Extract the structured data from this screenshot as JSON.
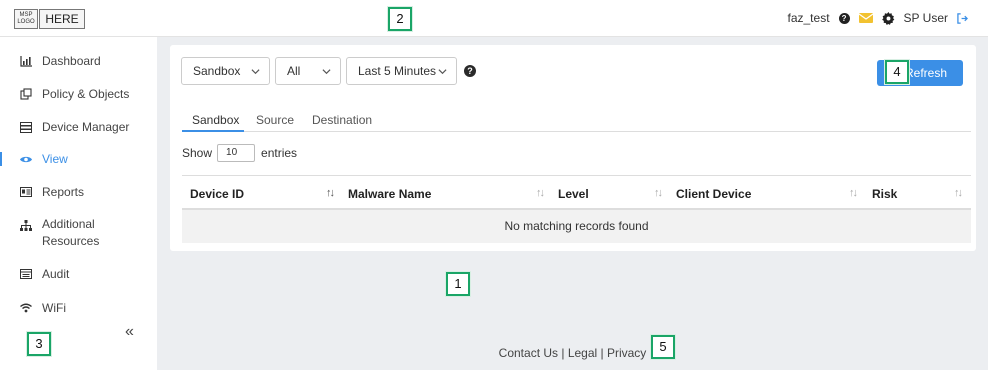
{
  "topbar": {
    "logo_text": "MSP LOGO",
    "here_label": "HERE",
    "username": "faz_test",
    "user_role_label": "SP User"
  },
  "sidebar": {
    "items": [
      {
        "label": "Dashboard",
        "icon": "bar-chart-icon"
      },
      {
        "label": "Policy & Objects",
        "icon": "objects-icon"
      },
      {
        "label": "Device Manager",
        "icon": "device-icon"
      },
      {
        "label": "View",
        "icon": "eye-icon",
        "active": true
      },
      {
        "label": "Reports",
        "icon": "reports-icon"
      },
      {
        "label": "Additional Resources",
        "icon": "sitemap-icon"
      },
      {
        "label": "Audit",
        "icon": "audit-icon"
      },
      {
        "label": "WiFi",
        "icon": "wifi-icon"
      }
    ],
    "collapse_label": "«"
  },
  "filters": {
    "type_value": "Sandbox",
    "scope_value": "All",
    "time_value": "Last 5 Minutes",
    "refresh_label": "Refresh"
  },
  "tabs": [
    "Sandbox",
    "Source",
    "Destination"
  ],
  "entries": {
    "show_label": "Show",
    "value": "10",
    "suffix": "entries"
  },
  "table": {
    "columns": [
      "Device ID",
      "Malware Name",
      "Level",
      "Client Device",
      "Risk"
    ],
    "empty_message": "No matching records found"
  },
  "footer": {
    "text": "Contact Us | Legal | Privacy"
  },
  "markers": [
    "1",
    "2",
    "3",
    "4",
    "5"
  ],
  "colors": {
    "accent": "#3b8fe6",
    "marker_border": "#1aa567",
    "mail_icon": "#f2c230"
  }
}
